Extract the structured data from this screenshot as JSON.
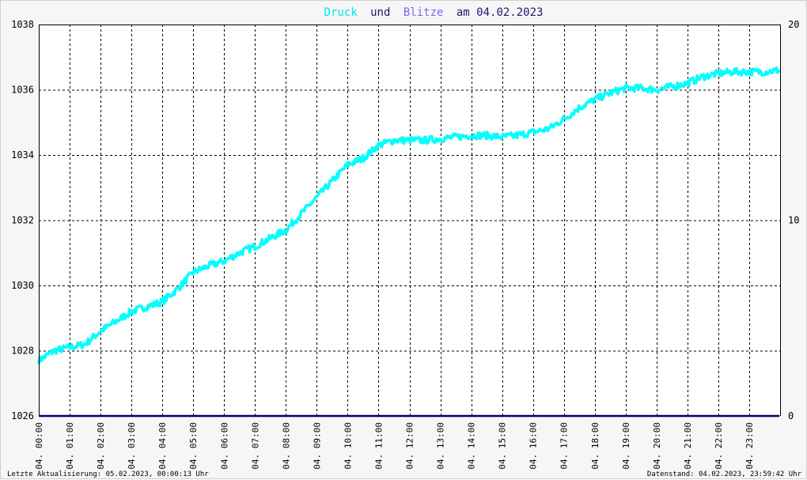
{
  "chart_data": {
    "type": "line",
    "title": {
      "druck": "Druck",
      "und": "und",
      "blitze": "Blitze",
      "am": "am 04.02.2023"
    },
    "xlabel": "",
    "ylabel": "",
    "ylim": [
      1026,
      1038
    ],
    "y2lim": [
      0,
      20
    ],
    "y_ticks": [
      "1026",
      "1028",
      "1030",
      "1032",
      "1034",
      "1036",
      "1038"
    ],
    "y2_ticks": [
      "0",
      "10",
      "20"
    ],
    "x_ticks": [
      "04. 00:00",
      "04. 01:00",
      "04. 02:00",
      "04. 03:00",
      "04. 04:00",
      "04. 05:00",
      "04. 06:00",
      "04. 07:00",
      "04. 08:00",
      "04. 09:00",
      "04. 10:00",
      "04. 11:00",
      "04. 12:00",
      "04. 13:00",
      "04. 14:00",
      "04. 15:00",
      "04. 16:00",
      "04. 17:00",
      "04. 18:00",
      "04. 19:00",
      "04. 20:00",
      "04. 21:00",
      "04. 22:00",
      "04. 23:00"
    ],
    "grid": true,
    "colors": {
      "druck": "#00ffff",
      "blitze": "#7b68ee",
      "blitze_line": "#000066",
      "grid": "#000000",
      "background": "#ffffff"
    },
    "series": [
      {
        "name": "Druck",
        "axis": "left",
        "x": [
          0,
          0.5,
          1,
          1.5,
          2,
          2.5,
          3,
          3.5,
          4,
          4.5,
          5,
          5.5,
          6,
          6.5,
          7,
          7.5,
          8,
          8.5,
          9,
          9.5,
          10,
          10.5,
          11,
          11.5,
          12,
          12.5,
          13,
          13.5,
          14,
          14.5,
          15,
          15.5,
          16,
          16.5,
          17,
          17.5,
          18,
          18.5,
          19,
          19.5,
          20,
          20.5,
          21,
          21.5,
          22,
          22.5,
          23,
          23.5,
          23.98
        ],
        "values": [
          1027.7,
          1028.0,
          1028.1,
          1028.2,
          1028.6,
          1028.9,
          1029.2,
          1029.35,
          1029.5,
          1029.9,
          1030.4,
          1030.6,
          1030.75,
          1031.0,
          1031.2,
          1031.45,
          1031.7,
          1032.2,
          1032.7,
          1033.2,
          1033.7,
          1033.9,
          1034.3,
          1034.45,
          1034.45,
          1034.45,
          1034.5,
          1034.55,
          1034.6,
          1034.6,
          1034.55,
          1034.6,
          1034.7,
          1034.8,
          1035.1,
          1035.45,
          1035.7,
          1035.9,
          1036.05,
          1036.05,
          1036.0,
          1036.1,
          1036.2,
          1036.4,
          1036.5,
          1036.55,
          1036.55,
          1036.55,
          1036.6
        ]
      },
      {
        "name": "Blitze",
        "axis": "right",
        "x": [
          0,
          23.98
        ],
        "values": [
          0,
          0
        ]
      }
    ]
  },
  "footer": {
    "left": "Letzte Aktualisierung: 05.02.2023, 00:00:13 Uhr",
    "right": "Datenstand: 04.02.2023, 23:59:42 Uhr"
  }
}
